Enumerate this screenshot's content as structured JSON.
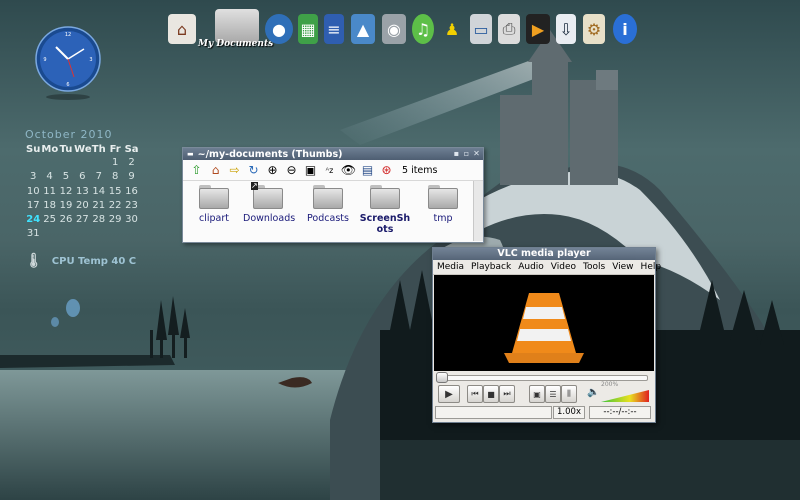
{
  "dock": {
    "items": [
      {
        "name": "home",
        "label": "My Documents"
      },
      {
        "name": "folder"
      },
      {
        "name": "firefox"
      },
      {
        "name": "spreadsheet"
      },
      {
        "name": "writer"
      },
      {
        "name": "image-viewer"
      },
      {
        "name": "harddisk"
      },
      {
        "name": "music"
      },
      {
        "name": "aim"
      },
      {
        "name": "computer"
      },
      {
        "name": "printer"
      },
      {
        "name": "video"
      },
      {
        "name": "install"
      },
      {
        "name": "settings"
      },
      {
        "name": "info"
      }
    ]
  },
  "calendar": {
    "title": "October  2010",
    "days": [
      "Su",
      "Mo",
      "Tu",
      "We",
      "Th",
      "Fr",
      "Sa"
    ],
    "rows": [
      [
        "",
        "",
        "",
        "",
        "",
        "1",
        "2"
      ],
      [
        "3",
        "4",
        "5",
        "6",
        "7",
        "8",
        "9"
      ],
      [
        "10",
        "11",
        "12",
        "13",
        "14",
        "15",
        "16"
      ],
      [
        "17",
        "18",
        "19",
        "20",
        "21",
        "22",
        "23"
      ],
      [
        "24",
        "25",
        "26",
        "27",
        "28",
        "29",
        "30"
      ],
      [
        "31",
        "",
        "",
        "",
        "",
        "",
        ""
      ]
    ],
    "today": "24"
  },
  "cpu": {
    "text": "CPU Temp 40 C"
  },
  "file_manager": {
    "title": "~/my-documents (Thumbs)",
    "item_count": "5 items",
    "files": [
      {
        "label": "clipart"
      },
      {
        "label": "Downloads"
      },
      {
        "label": "Podcasts"
      },
      {
        "label": "ScreenShots"
      },
      {
        "label": "tmp"
      }
    ]
  },
  "vlc": {
    "title": "VLC media player",
    "menu": [
      "Media",
      "Playback",
      "Audio",
      "Video",
      "Tools",
      "View",
      "Help"
    ],
    "volume_label": "200%",
    "speed": "1.00x",
    "time": "--:--/--:--"
  },
  "colors": {
    "accent": "#3fe3ff",
    "title_bar": "#5a6a7e"
  }
}
